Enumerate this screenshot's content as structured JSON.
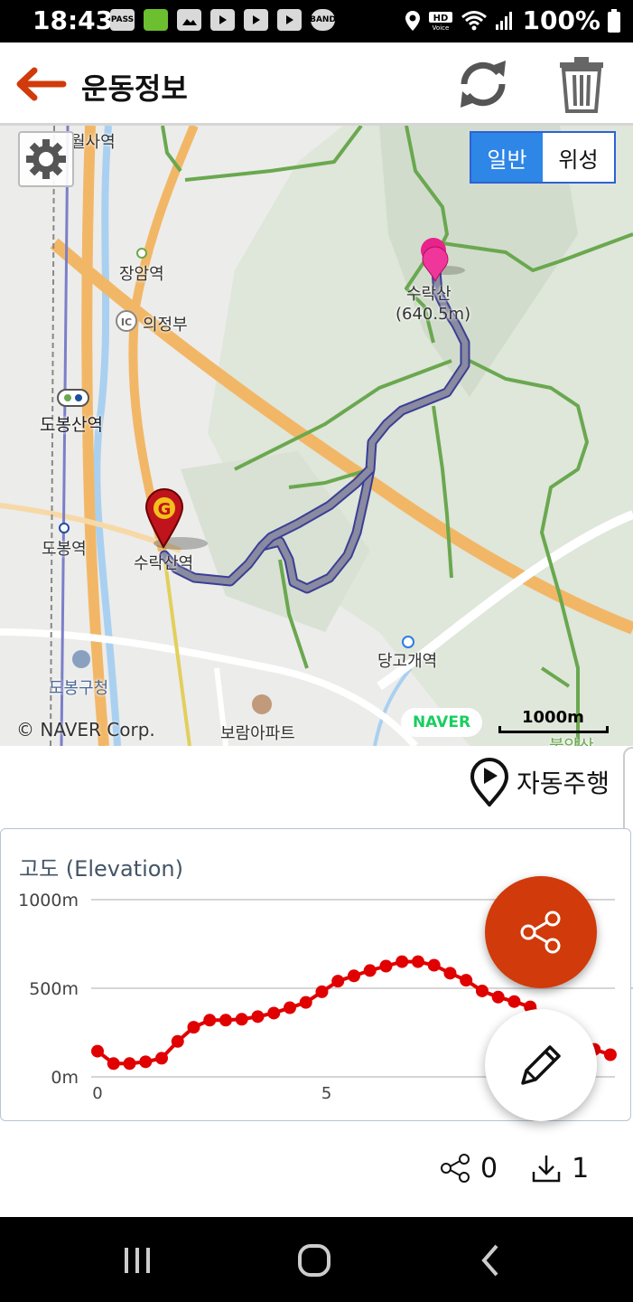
{
  "status": {
    "time": "18:43",
    "battery": "100%",
    "icons": [
      "PASS",
      "app-icon",
      "gallery-icon",
      "youtube-icon",
      "youtube-icon",
      "youtube-icon",
      "BAND"
    ]
  },
  "header": {
    "title": "운동정보"
  },
  "map": {
    "labels": {
      "station_top": "월사역",
      "jangam": "장암역",
      "ic": "IC",
      "uijeongbu": "의정부",
      "dobongsan": "도봉산역",
      "dobong": "도봉역",
      "suraksan_station": "수락산역",
      "suraksan": "수락산",
      "elevation": "(640.5m)",
      "danggogae": "당고개역",
      "dobong_office": "도봉구청",
      "apartment": "보람아파트",
      "bottom_right": "불암산"
    },
    "map_type": {
      "normal": "일반",
      "satellite": "위성",
      "selected": "normal"
    },
    "copyright": "© NAVER Corp.",
    "logo": "NAVER",
    "scale": "1000m",
    "goal_marker": "G",
    "colors": {
      "route": "#6f6f84",
      "trail": "#6aa84f",
      "road": "#f2b766",
      "goal": "#c0141c",
      "start": "#e8238c"
    }
  },
  "autoplay_label": "자동주행",
  "elevation_chart": {
    "title": "고도 (Elevation)"
  },
  "chart_data": {
    "type": "line",
    "title": "고도 (Elevation)",
    "xlabel": "",
    "ylabel": "",
    "ytick_labels": [
      "1000m",
      "500m",
      "0m"
    ],
    "xtick_labels": [
      "0",
      "5"
    ],
    "ylim": [
      0,
      1000
    ],
    "xlim": [
      0,
      11.3
    ],
    "color": "#e00000",
    "grid": true,
    "series": [
      {
        "values": [
          [
            0,
            145
          ],
          [
            0.35,
            75
          ],
          [
            0.7,
            75
          ],
          [
            1.05,
            85
          ],
          [
            1.4,
            105
          ],
          [
            1.75,
            200
          ],
          [
            2.1,
            280
          ],
          [
            2.45,
            320
          ],
          [
            2.8,
            320
          ],
          [
            3.15,
            325
          ],
          [
            3.5,
            340
          ],
          [
            3.85,
            360
          ],
          [
            4.2,
            390
          ],
          [
            4.55,
            420
          ],
          [
            4.9,
            480
          ],
          [
            5.25,
            540
          ],
          [
            5.6,
            570
          ],
          [
            5.95,
            600
          ],
          [
            6.3,
            625
          ],
          [
            6.65,
            650
          ],
          [
            7.0,
            650
          ],
          [
            7.35,
            630
          ],
          [
            7.7,
            585
          ],
          [
            8.05,
            545
          ],
          [
            8.4,
            485
          ],
          [
            8.75,
            450
          ],
          [
            9.1,
            425
          ],
          [
            9.45,
            395
          ],
          [
            9.8,
            340
          ],
          [
            10.15,
            280
          ],
          [
            10.5,
            215
          ],
          [
            10.85,
            155
          ],
          [
            11.2,
            125
          ]
        ]
      }
    ]
  },
  "stats": {
    "share_count": "0",
    "download_count": "1"
  }
}
